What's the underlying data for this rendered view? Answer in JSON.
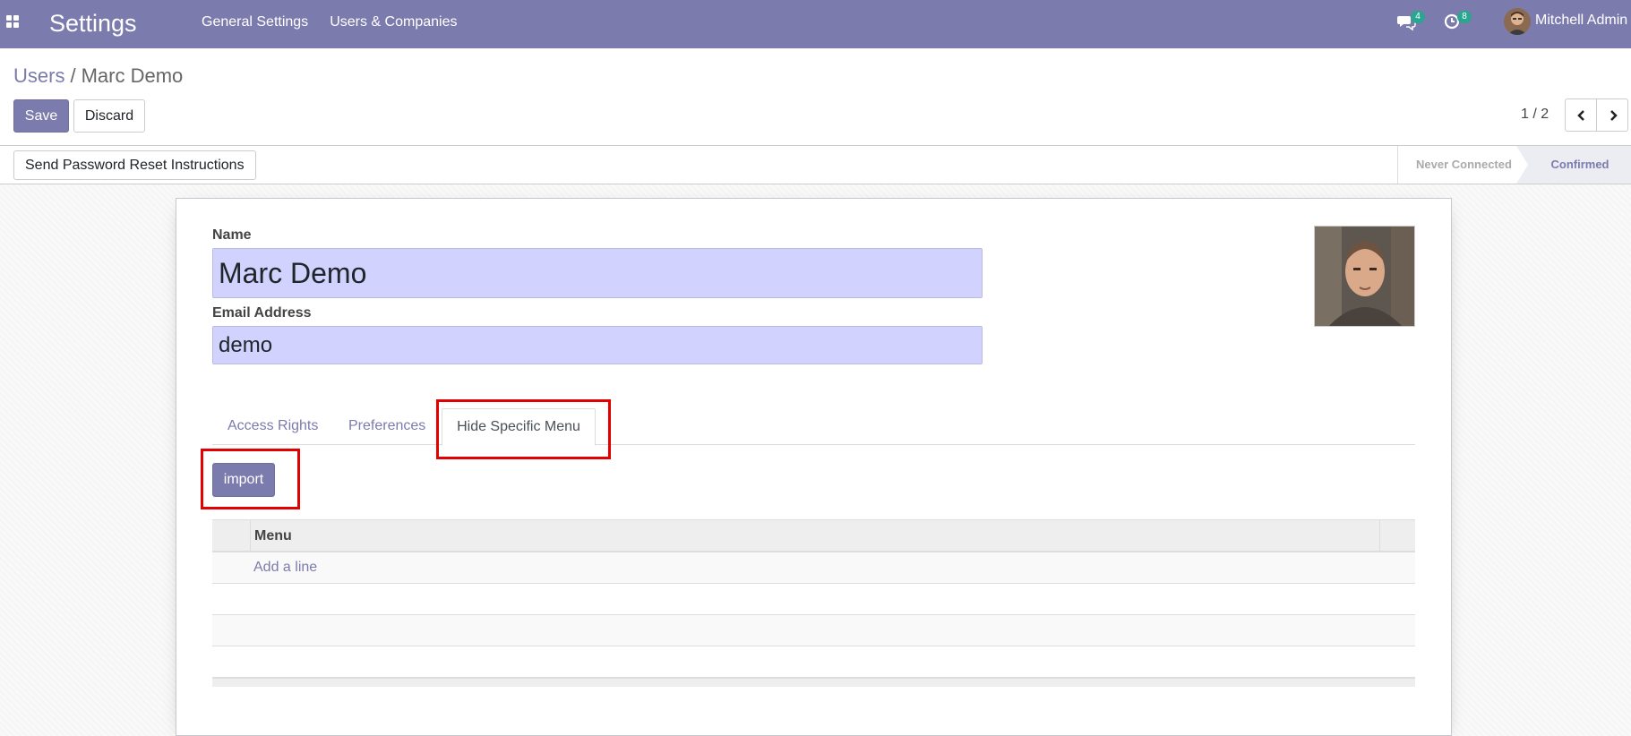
{
  "navbar": {
    "app_name": "Settings",
    "menu": [
      "General Settings",
      "Users & Companies"
    ],
    "messages_count": "4",
    "activities_count": "8",
    "user_name": "Mitchell Admin",
    "color": "#7c7bad"
  },
  "breadcrumb": {
    "parent": "Users",
    "separator": "/",
    "current": "Marc Demo"
  },
  "buttons": {
    "save": "Save",
    "discard": "Discard",
    "reset_password": "Send Password Reset Instructions",
    "import": "import"
  },
  "pager": {
    "value": "1 / 2"
  },
  "status": {
    "stages": [
      "Never Connected",
      "Confirmed"
    ],
    "active": "Confirmed"
  },
  "form": {
    "name_label": "Name",
    "name_value": "Marc Demo",
    "email_label": "Email Address",
    "email_value": "demo"
  },
  "tabs": [
    "Access Rights",
    "Preferences",
    "Hide Specific Menu"
  ],
  "active_tab": "Hide Specific Menu",
  "table": {
    "column_header": "Menu",
    "add_line": "Add a line"
  },
  "icons": [
    "apps-icon",
    "chat-icon",
    "clock-icon",
    "chevron-left-icon",
    "chevron-right-icon"
  ]
}
